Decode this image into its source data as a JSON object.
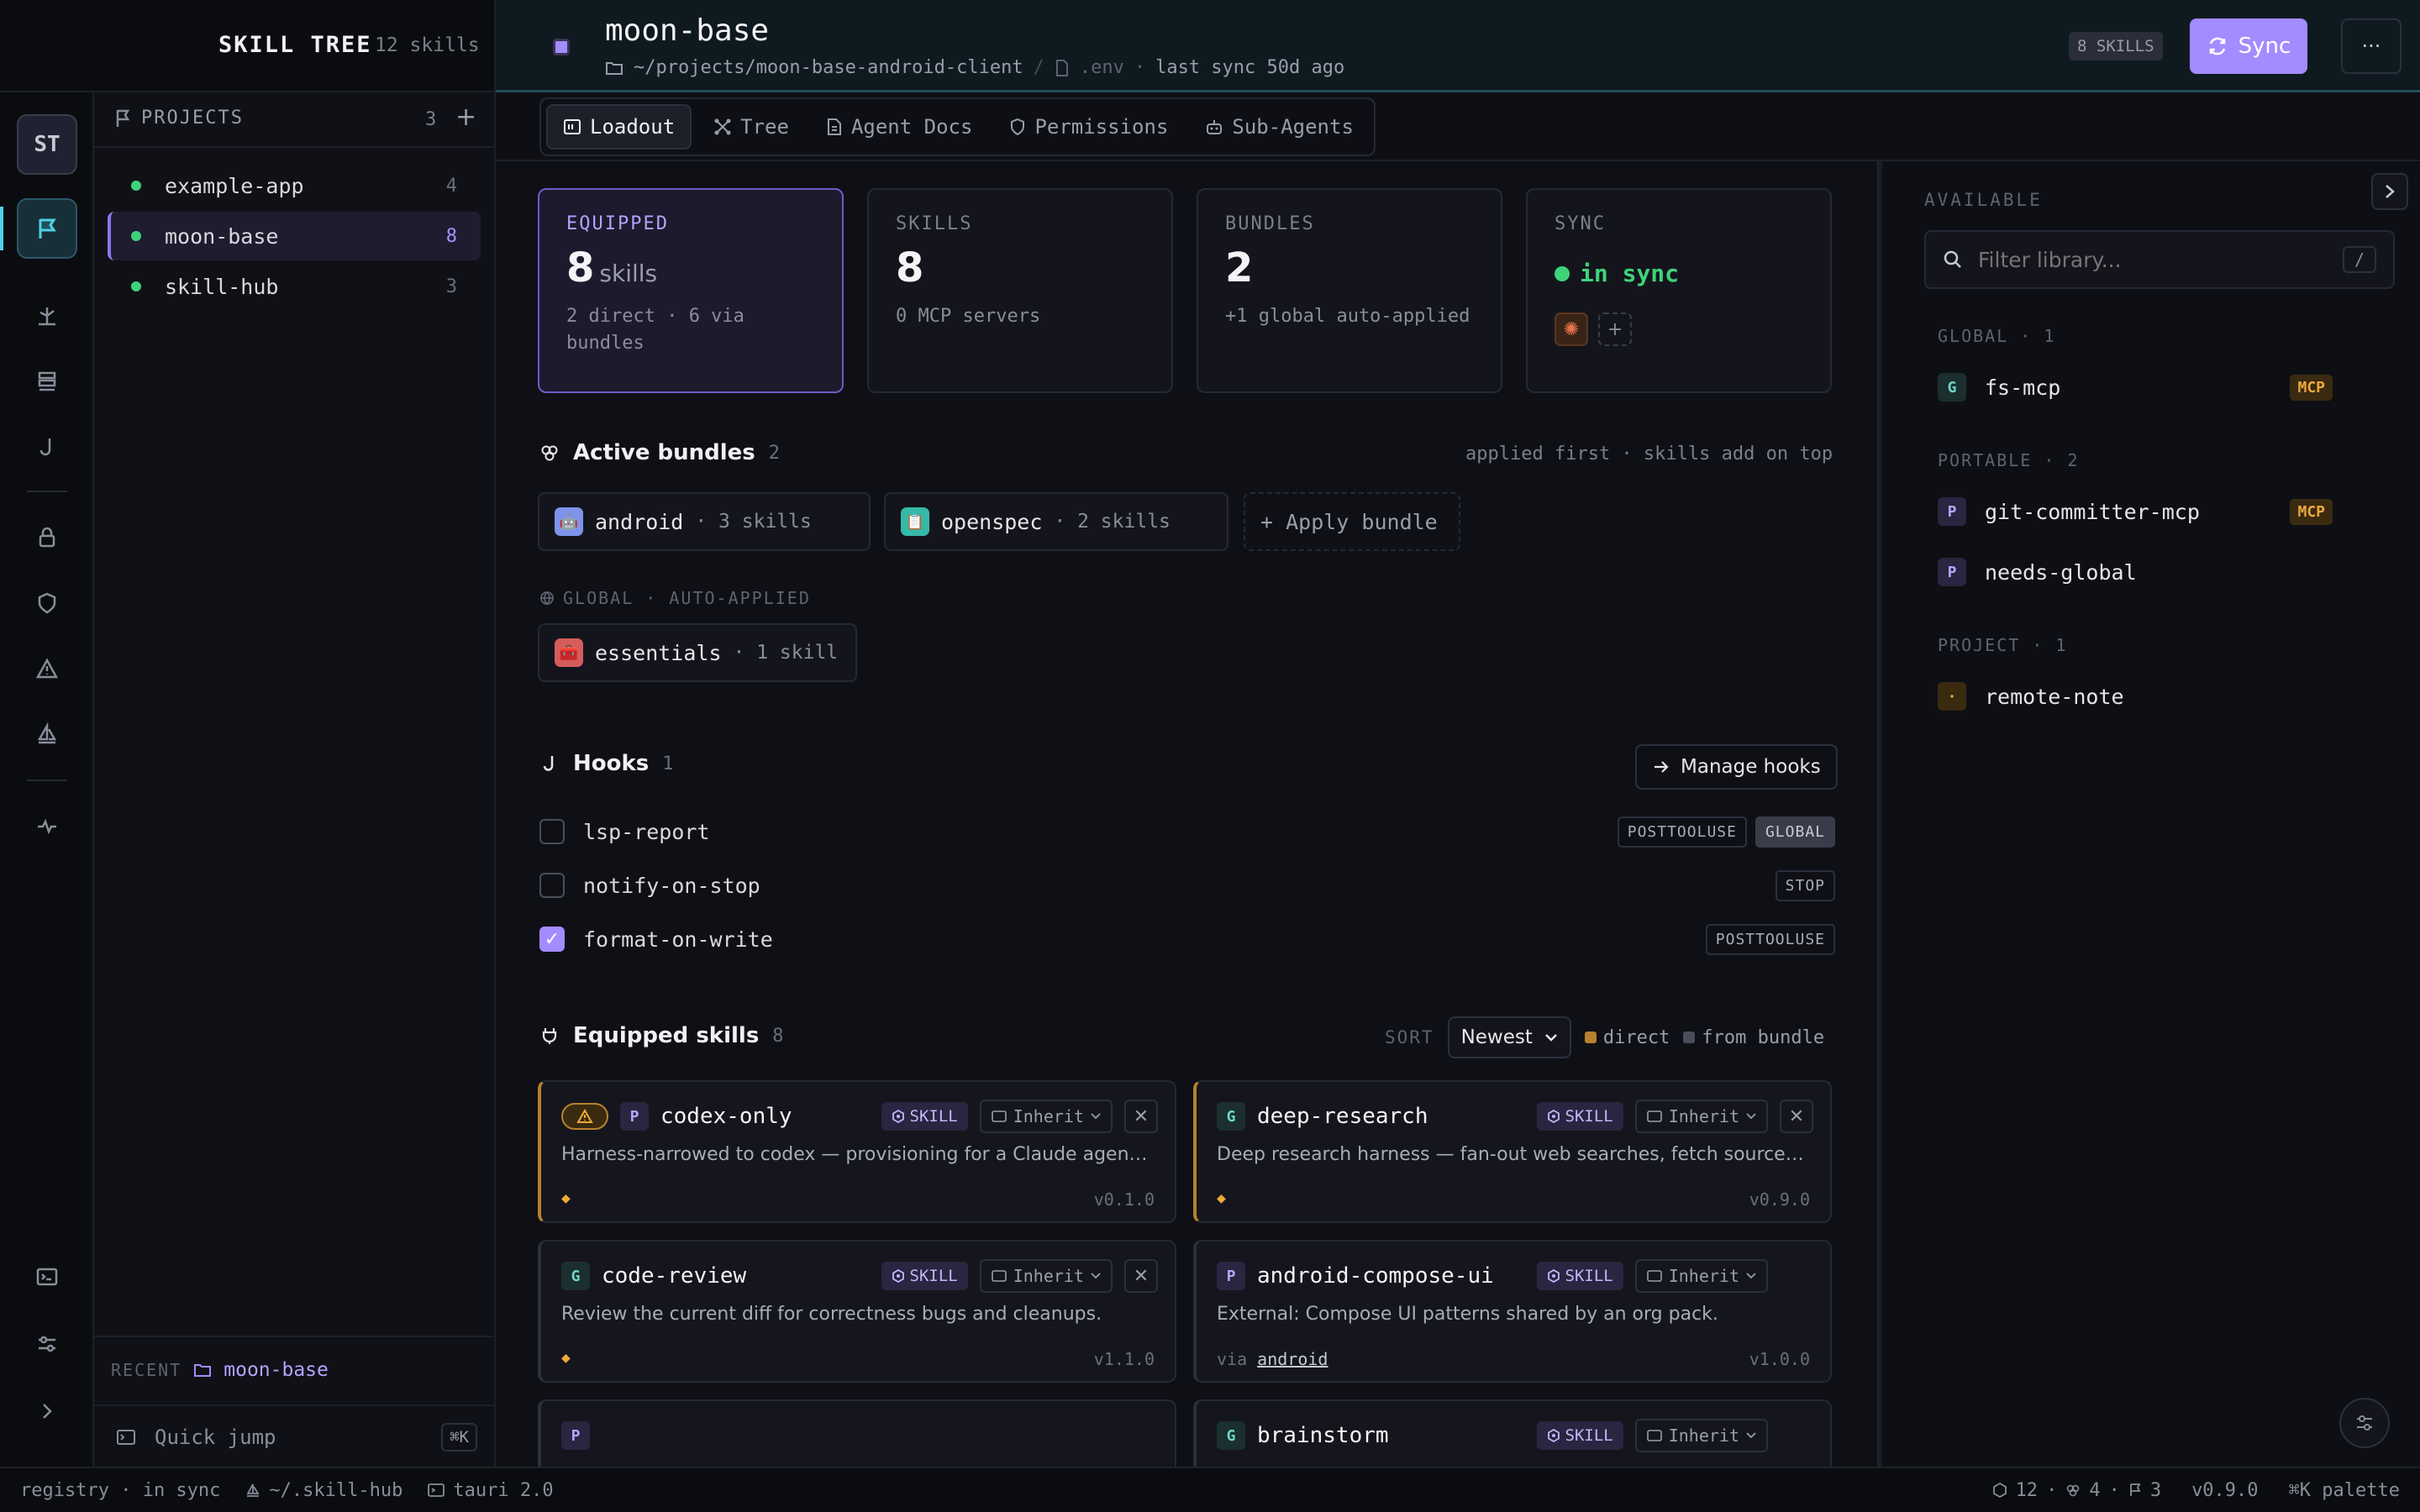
{
  "brand": {
    "name": "SKILL TREE",
    "count": "12 skills"
  },
  "rail": {
    "avatar": "ST"
  },
  "projects": {
    "header": "PROJECTS",
    "count": "3",
    "add": "+",
    "items": [
      {
        "name": "example-app",
        "count": "4"
      },
      {
        "name": "moon-base",
        "count": "8"
      },
      {
        "name": "skill-hub",
        "count": "3"
      }
    ],
    "recent_label": "RECENT",
    "recent_value": "moon-base",
    "quick_jump": "Quick jump",
    "quick_jump_key": "⌘K"
  },
  "header": {
    "title": "moon-base",
    "path": "~/projects/moon-base-android-client",
    "sep": "/",
    "env": ".env",
    "dot": "·",
    "last_sync": "last sync 50d ago",
    "skills_badge": "8 SKILLS",
    "sync_label": "Sync",
    "more": "···"
  },
  "tabs": [
    {
      "label": "Loadout",
      "icon": "loadout-icon"
    },
    {
      "label": "Tree",
      "icon": "tree-icon"
    },
    {
      "label": "Agent Docs",
      "icon": "doc-icon"
    },
    {
      "label": "Permissions",
      "icon": "shield-icon"
    },
    {
      "label": "Sub-Agents",
      "icon": "robot-icon"
    }
  ],
  "stats": {
    "equipped": {
      "label": "EQUIPPED",
      "value": "8",
      "unit": "skills",
      "sub": "2 direct · 6 via bundles"
    },
    "skills": {
      "label": "SKILLS",
      "value": "8",
      "sub": "0 MCP servers"
    },
    "bundles": {
      "label": "BUNDLES",
      "value": "2",
      "sub": "+1 global auto-applied"
    },
    "sync": {
      "label": "SYNC",
      "value": "in sync",
      "add": "+"
    }
  },
  "bundles": {
    "title": "Active bundles",
    "count": "2",
    "note": "applied first · skills add on top",
    "items": [
      {
        "name": "android",
        "sub": "· 3 skills"
      },
      {
        "name": "openspec",
        "sub": "· 2 skills"
      }
    ],
    "apply": "+ Apply bundle",
    "global_label": "GLOBAL · AUTO-APPLIED",
    "global_item": {
      "name": "essentials",
      "sub": "· 1 skill"
    }
  },
  "hooks": {
    "title": "Hooks",
    "count": "1",
    "manage": "Manage hooks",
    "items": [
      {
        "name": "lsp-report",
        "checked": false,
        "tags": [
          "POSTTOOLUSE",
          "GLOBAL"
        ]
      },
      {
        "name": "notify-on-stop",
        "checked": false,
        "tags": [
          "STOP"
        ]
      },
      {
        "name": "format-on-write",
        "checked": true,
        "tags": [
          "POSTTOOLUSE"
        ]
      }
    ]
  },
  "equipped": {
    "title": "Equipped skills",
    "count": "8",
    "sort_label": "SORT",
    "sort_value": "Newest",
    "legend_direct": "direct",
    "legend_bundle": "from bundle",
    "cards": [
      {
        "letter": "P",
        "name": "codex-only",
        "tag": "SKILL",
        "inherit": "Inherit",
        "desc": "Harness-narrowed to codex — provisioning for a Claude agent off...",
        "version": "v0.1.0",
        "warn": true,
        "remove": "✕",
        "via": "",
        "via_link": ""
      },
      {
        "letter": "G",
        "name": "deep-research",
        "tag": "SKILL",
        "inherit": "Inherit",
        "desc": "Deep research harness — fan-out web searches, fetch sources, ve...",
        "version": "v0.9.0",
        "warn": false,
        "remove": "✕",
        "via": "",
        "via_link": ""
      },
      {
        "letter": "G",
        "name": "code-review",
        "tag": "SKILL",
        "inherit": "Inherit",
        "desc": "Review the current diff for correctness bugs and cleanups.",
        "version": "v1.1.0",
        "warn": false,
        "remove": "✕",
        "via": "",
        "via_link": ""
      },
      {
        "letter": "P",
        "name": "android-compose-ui",
        "tag": "SKILL",
        "inherit": "Inherit",
        "desc": "External: Compose UI patterns shared by an org pack.",
        "version": "v1.0.0",
        "warn": false,
        "remove": "",
        "via": "via",
        "via_link": "android"
      },
      {
        "letter": "P",
        "name": "",
        "tag": "",
        "inherit": "",
        "desc": "",
        "version": "",
        "warn": false,
        "remove": "",
        "via": "",
        "via_link": ""
      },
      {
        "letter": "G",
        "name": "brainstorm",
        "tag": "SKILL",
        "inherit": "Inherit",
        "desc": "",
        "version": "",
        "warn": false,
        "remove": "",
        "via": "",
        "via_link": ""
      }
    ]
  },
  "library": {
    "title": "AVAILABLE",
    "filter_placeholder": "Filter library...",
    "filter_key": "/",
    "sections": [
      {
        "label": "GLOBAL · 1",
        "items": [
          {
            "letter": "G",
            "name": "fs-mcp",
            "mcp": "MCP"
          }
        ]
      },
      {
        "label": "PORTABLE · 2",
        "items": [
          {
            "letter": "P",
            "name": "git-committer-mcp",
            "mcp": "MCP"
          },
          {
            "letter": "P",
            "name": "needs-global",
            "mcp": ""
          }
        ]
      },
      {
        "label": "PROJECT · 1",
        "items": [
          {
            "letter": "·",
            "name": "remote-note",
            "mcp": ""
          }
        ]
      }
    ]
  },
  "statusbar": {
    "registry": "registry · in sync",
    "home": "~/.skill-hub",
    "tauri": "tauri 2.0",
    "skills": "12",
    "bundles": "4",
    "projects": "3",
    "version": "v0.9.0",
    "palette": "⌘K palette"
  },
  "colors": {
    "accent": "#a38cff",
    "sync_ok": "#3ed37a",
    "mcp": "#f0a93a"
  }
}
